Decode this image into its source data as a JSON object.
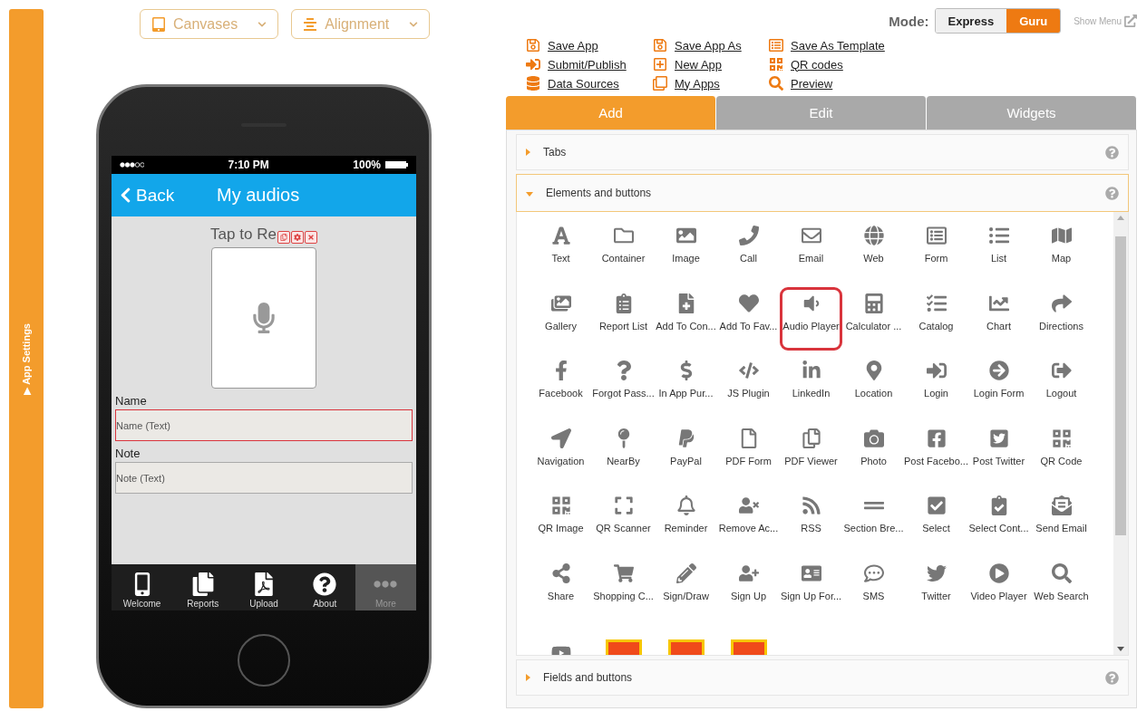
{
  "sidebar": {
    "arrow": "▶",
    "label": "App Settings"
  },
  "toolbar": [
    {
      "label": "Canvases"
    },
    {
      "label": "Alignment"
    }
  ],
  "phone": {
    "status": {
      "time": "7:10 PM",
      "battery": "100%"
    },
    "nav": {
      "back": "Back",
      "title": "My audios"
    },
    "record_label": "Tap to Re",
    "fields": [
      {
        "label": "Name",
        "placeholder": "Name (Text)",
        "selected": true
      },
      {
        "label": "Note",
        "placeholder": "Note (Text)",
        "selected": false
      }
    ],
    "tabbar": [
      {
        "label": "Welcome",
        "selected": false
      },
      {
        "label": "Reports",
        "selected": false
      },
      {
        "label": "Upload",
        "selected": false
      },
      {
        "label": "About",
        "selected": false
      },
      {
        "label": "More",
        "selected": true
      }
    ]
  },
  "mode": {
    "label": "Mode:",
    "options": [
      {
        "label": "Express",
        "selected": false
      },
      {
        "label": "Guru",
        "selected": true
      }
    ],
    "show_menu": "Show Menu"
  },
  "actions": [
    "Save App",
    "Save App As",
    "Save As Template",
    "Submit/Publish",
    "New App",
    "QR codes",
    "Data Sources",
    "My Apps",
    "Preview"
  ],
  "tabs": [
    {
      "label": "Add",
      "selected": true
    },
    {
      "label": "Edit",
      "selected": false
    },
    {
      "label": "Widgets",
      "selected": false
    }
  ],
  "sections": [
    {
      "title": "Tabs",
      "expanded": false
    },
    {
      "title": "Elements and buttons",
      "expanded": true,
      "items": [
        {
          "kind": "element",
          "label": "Text",
          "selected": false
        },
        {
          "kind": "element",
          "label": "Container",
          "selected": false
        },
        {
          "kind": "element",
          "label": "Image",
          "selected": false
        },
        {
          "kind": "element",
          "label": "Call",
          "selected": false
        },
        {
          "kind": "element",
          "label": "Email",
          "selected": false
        },
        {
          "kind": "element",
          "label": "Web",
          "selected": false
        },
        {
          "kind": "element",
          "label": "Form",
          "selected": false
        },
        {
          "kind": "element",
          "label": "List",
          "selected": false
        },
        {
          "kind": "element",
          "label": "Map",
          "selected": false
        },
        {
          "kind": "element",
          "label": "Gallery",
          "selected": false
        },
        {
          "kind": "element",
          "label": "Report List",
          "selected": false
        },
        {
          "kind": "element",
          "label": "Add To Con...",
          "selected": false
        },
        {
          "kind": "element",
          "label": "Add To Fav...",
          "selected": false
        },
        {
          "kind": "element",
          "label": "Audio Player",
          "selected": true
        },
        {
          "kind": "element",
          "label": "Calculator ...",
          "selected": false
        },
        {
          "kind": "element",
          "label": "Catalog",
          "selected": false
        },
        {
          "kind": "element",
          "label": "Chart",
          "selected": false
        },
        {
          "kind": "element",
          "label": "Directions",
          "selected": false
        },
        {
          "kind": "element",
          "label": "Facebook",
          "selected": false
        },
        {
          "kind": "element",
          "label": "Forgot Pass...",
          "selected": false
        },
        {
          "kind": "element",
          "label": "In App Pur...",
          "selected": false
        },
        {
          "kind": "element",
          "label": "JS Plugin",
          "selected": false
        },
        {
          "kind": "element",
          "label": "LinkedIn",
          "selected": false
        },
        {
          "kind": "element",
          "label": "Location",
          "selected": false
        },
        {
          "kind": "element",
          "label": "Login",
          "selected": false
        },
        {
          "kind": "element",
          "label": "Login Form",
          "selected": false
        },
        {
          "kind": "element",
          "label": "Logout",
          "selected": false
        },
        {
          "kind": "element",
          "label": "Navigation",
          "selected": false
        },
        {
          "kind": "element",
          "label": "NearBy",
          "selected": false
        },
        {
          "kind": "element",
          "label": "PayPal",
          "selected": false
        },
        {
          "kind": "element",
          "label": "PDF Form",
          "selected": false
        },
        {
          "kind": "element",
          "label": "PDF Viewer",
          "selected": false
        },
        {
          "kind": "element",
          "label": "Photo",
          "selected": false
        },
        {
          "kind": "element",
          "label": "Post Facebo...",
          "selected": false
        },
        {
          "kind": "element",
          "label": "Post Twitter",
          "selected": false
        },
        {
          "kind": "element",
          "label": "QR Code",
          "selected": false
        },
        {
          "kind": "element",
          "label": "QR Image",
          "selected": false
        },
        {
          "kind": "element",
          "label": "QR Scanner",
          "selected": false
        },
        {
          "kind": "element",
          "label": "Reminder",
          "selected": false
        },
        {
          "kind": "element",
          "label": "Remove Ac...",
          "selected": false
        },
        {
          "kind": "element",
          "label": "RSS",
          "selected": false
        },
        {
          "kind": "element",
          "label": "Section Bre...",
          "selected": false
        },
        {
          "kind": "element",
          "label": "Select",
          "selected": false
        },
        {
          "kind": "element",
          "label": "Select Cont...",
          "selected": false
        },
        {
          "kind": "element",
          "label": "Send Email",
          "selected": false
        },
        {
          "kind": "element",
          "label": "Share",
          "selected": false
        },
        {
          "kind": "element",
          "label": "Shopping C...",
          "selected": false
        },
        {
          "kind": "element",
          "label": "Sign/Draw",
          "selected": false
        },
        {
          "kind": "element",
          "label": "Sign Up",
          "selected": false
        },
        {
          "kind": "element",
          "label": "Sign Up For...",
          "selected": false
        },
        {
          "kind": "element",
          "label": "SMS",
          "selected": false
        },
        {
          "kind": "element",
          "label": "Twitter",
          "selected": false
        },
        {
          "kind": "element",
          "label": "Video Player",
          "selected": false
        },
        {
          "kind": "element",
          "label": "Web Search",
          "selected": false
        },
        {
          "kind": "video",
          "selected": false
        },
        {
          "kind": "widget",
          "selected": false
        },
        {
          "kind": "widget",
          "selected": false
        },
        {
          "kind": "widget",
          "selected": false
        }
      ]
    },
    {
      "title": "Fields and buttons",
      "expanded": false
    }
  ]
}
